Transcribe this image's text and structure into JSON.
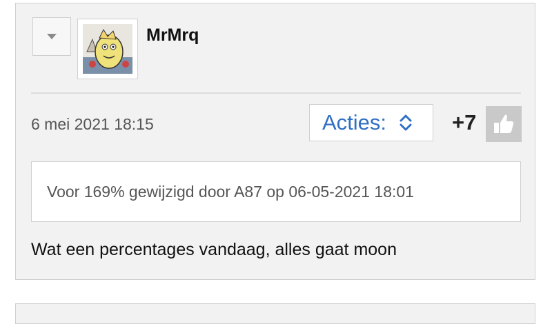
{
  "post": {
    "username": "MrMrq",
    "timestamp": "6 mei 2021 18:15",
    "actions_label": "Acties:",
    "score": "+7",
    "edit_note": "Voor 169% gewijzigd door A87 op 06-05-2021 18:01",
    "body": "Wat een percentages vandaag, alles gaat moon",
    "icons": {
      "collapse": "triangle-down-icon",
      "actions": "chevron-up-down-icon",
      "like": "thumbs-up-icon"
    },
    "colors": {
      "accent": "#2f6fc4",
      "post_background": "#f2f2f2",
      "like_button": "#c9c9c9"
    }
  }
}
